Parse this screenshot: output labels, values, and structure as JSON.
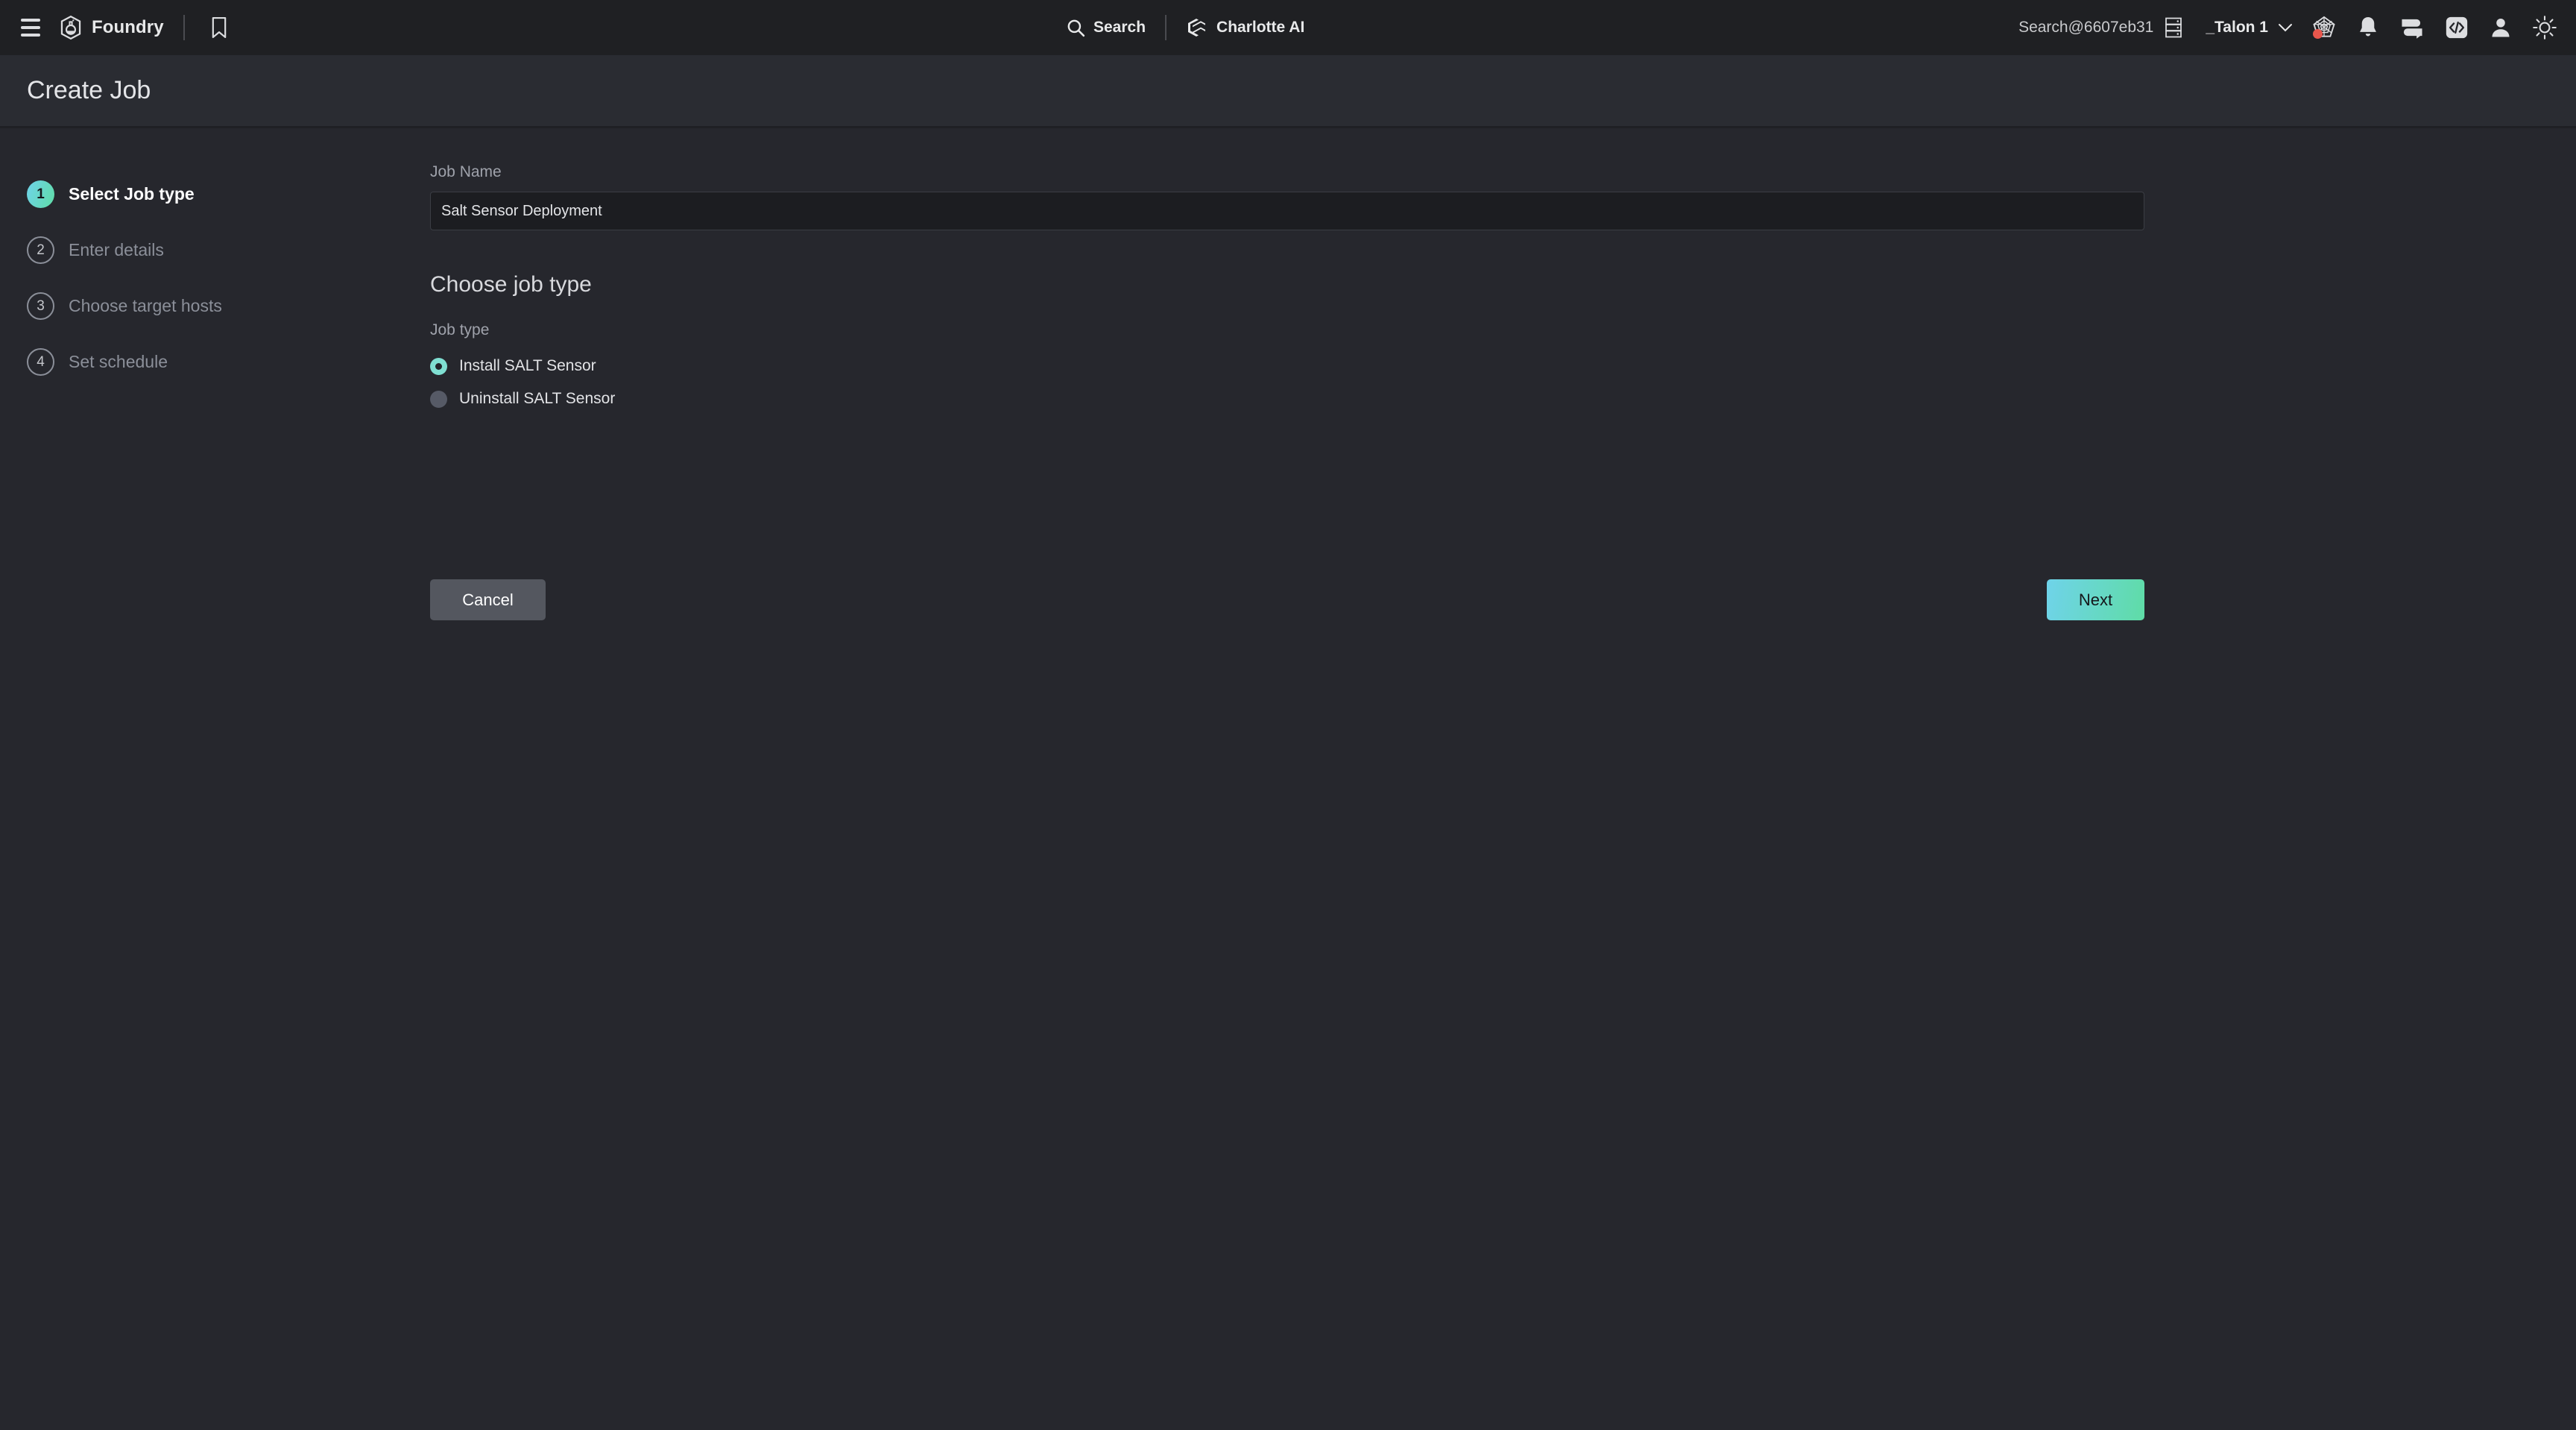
{
  "topbar": {
    "menu_icon": "hamburger-menu-icon",
    "brand_icon": "foundry-logo-icon",
    "brand_name": "Foundry",
    "bookmark_icon": "bookmark-icon",
    "search": {
      "icon": "search-icon",
      "label": "Search"
    },
    "charlotte": {
      "icon": "charlotte-ai-icon",
      "label": "Charlotte AI"
    },
    "cid": {
      "label": "Search@6607eb31",
      "icon": "server-rack-icon"
    },
    "tenant": {
      "label": "_Talon 1",
      "chevron": "chevron-down-icon"
    },
    "icons": [
      {
        "name": "spider-web-icon",
        "has_notification": true
      },
      {
        "name": "bell-icon",
        "has_notification": false
      },
      {
        "name": "feedback-icon",
        "has_notification": false
      },
      {
        "name": "code-icon",
        "has_notification": false
      },
      {
        "name": "user-avatar-icon",
        "has_notification": false
      },
      {
        "name": "theme-toggle-sun-icon",
        "has_notification": false
      }
    ]
  },
  "page": {
    "title": "Create Job"
  },
  "stepper": {
    "steps": [
      {
        "number": "1",
        "label": "Select Job type",
        "state": "active"
      },
      {
        "number": "2",
        "label": "Enter details",
        "state": "inactive"
      },
      {
        "number": "3",
        "label": "Choose target hosts",
        "state": "inactive"
      },
      {
        "number": "4",
        "label": "Set schedule",
        "state": "inactive"
      }
    ]
  },
  "form": {
    "job_name_label": "Job Name",
    "job_name_value": "Salt Sensor Deployment",
    "job_name_placeholder": "Job Name",
    "section_heading": "Choose job type",
    "job_type_label": "Job type",
    "options": [
      {
        "label": "Install SALT Sensor",
        "selected": true
      },
      {
        "label": "Uninstall SALT Sensor",
        "selected": false
      }
    ]
  },
  "actions": {
    "cancel_label": "Cancel",
    "next_label": "Next"
  },
  "colors": {
    "accent_start": "#6fd3ea",
    "accent_end": "#5fdca6",
    "radio_selected": "#7fdfd2",
    "notification_dot": "#e8564c",
    "topbar_bg": "#1f2023",
    "titlebar_bg": "#2a2c32",
    "body_bg": "#26272d"
  }
}
